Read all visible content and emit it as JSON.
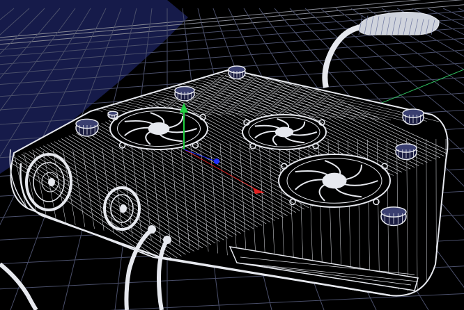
{
  "viewport": {
    "view": "perspective",
    "render_mode": "wireframe",
    "colors": {
      "sky_backdrop": "#161b4a",
      "background_black": "#000000",
      "grid": "#4a4f6a",
      "grid_far": "#8a8c96",
      "wireframe": "#e6e8ee",
      "gizmo_x": "#e02020",
      "gizmo_y": "#20d040",
      "gizmo_z": "#2030ff",
      "axis_line": "#30c060"
    }
  },
  "scene": {
    "object": "laptop-cooling-pad-wireframe",
    "fans": 3,
    "side_fans": 2,
    "knobs": 7,
    "cables": 3,
    "usb_lamp": true
  },
  "gizmo": {
    "type": "move",
    "axes": [
      "x",
      "y",
      "z"
    ]
  }
}
